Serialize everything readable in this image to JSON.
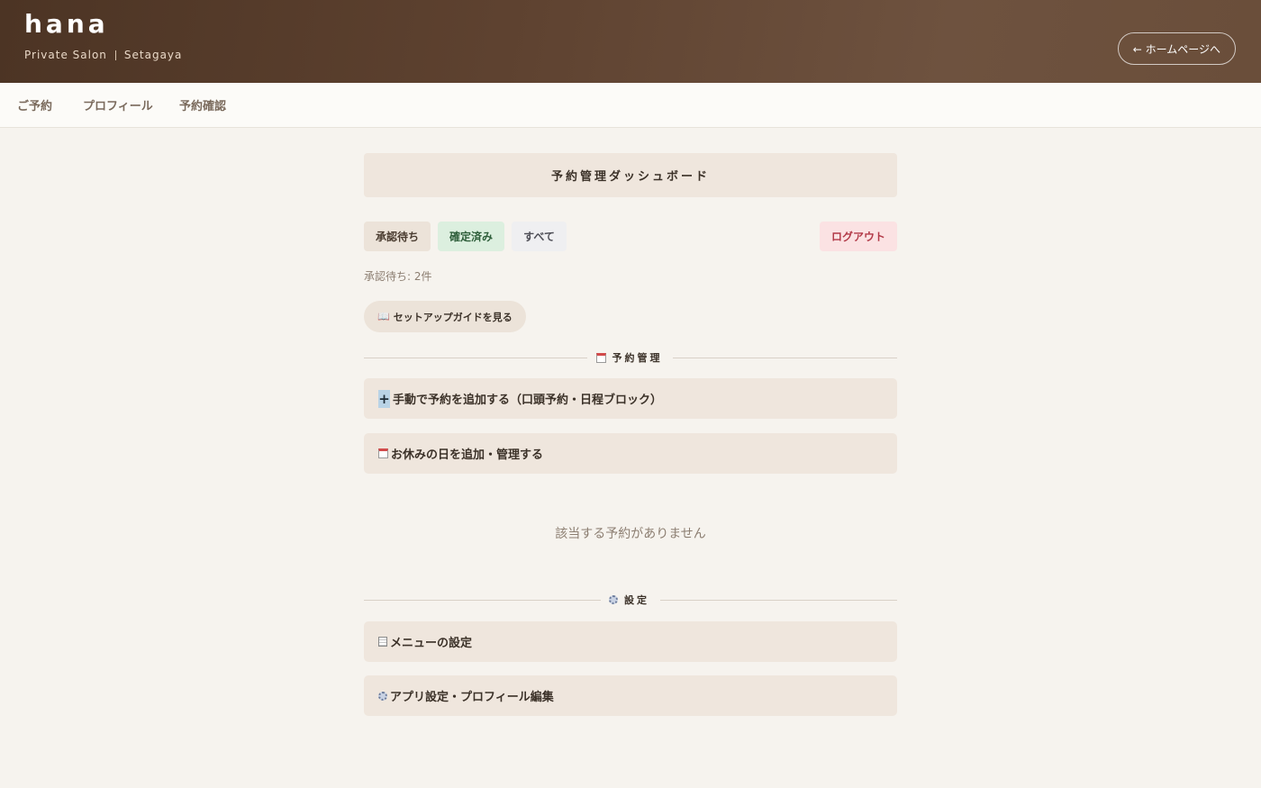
{
  "header": {
    "brand": "hana",
    "tagline_left": "Private Salon",
    "tagline_right": "Setagaya",
    "home_button": "← ホームページへ"
  },
  "nav": {
    "items": [
      {
        "label": "ご予約"
      },
      {
        "label": "プロフィール"
      },
      {
        "label": "予約確認"
      }
    ]
  },
  "main": {
    "title": "予約管理ダッシュボード",
    "filters": {
      "pending": "承認待ち",
      "confirmed": "確定済み",
      "all": "すべて",
      "logout": "ログアウト"
    },
    "pending_count": "承認待ち: 2件",
    "guide_button": "セットアップガイドを見る",
    "reservation_section": {
      "title": "予約管理",
      "icon": "calendar-icon",
      "actions": [
        {
          "label": "手動で予約を追加する（口頭予約・日程ブロック）",
          "icon": "plus-icon"
        },
        {
          "label": "お休みの日を追加・管理する",
          "icon": "calendar-icon"
        }
      ]
    },
    "empty_message": "該当する予約がありません",
    "settings_section": {
      "title": "設定",
      "icon": "gear-icon",
      "actions": [
        {
          "label": "メニューの設定",
          "icon": "document-icon"
        },
        {
          "label": "アプリ設定・プロフィール編集",
          "icon": "gear-icon"
        }
      ]
    }
  },
  "colors": {
    "header_bg": "#5e4230",
    "page_bg": "#f6f3ee",
    "card_bg": "#efe6dd",
    "confirmed_bg": "#dcefdf",
    "logout_bg": "#fbe2e3",
    "logout_text": "#b23a48"
  }
}
